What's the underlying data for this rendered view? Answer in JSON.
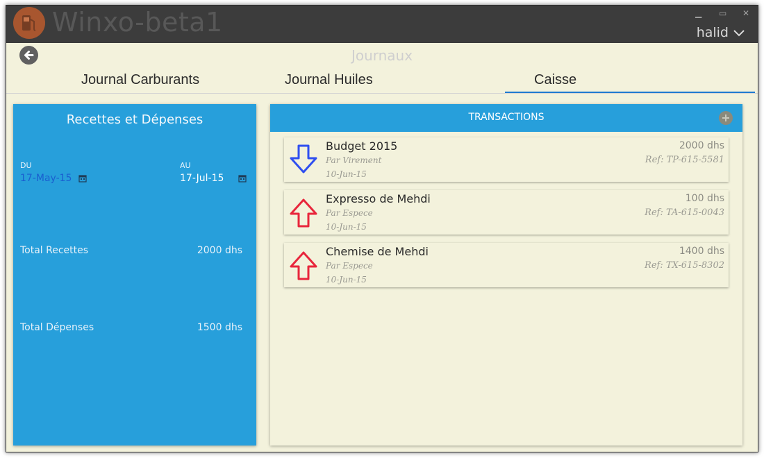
{
  "app": {
    "title": "Winxo-beta1",
    "logo_icon": "fuel-pump-icon"
  },
  "window_controls": {
    "minimize": "▁",
    "maximize": "▭",
    "close": "✕"
  },
  "user": {
    "name": "halid"
  },
  "page": {
    "title": "Journaux"
  },
  "tabs": [
    {
      "label": "Journal Carburants",
      "selected": false
    },
    {
      "label": "Journal Huiles",
      "selected": false
    },
    {
      "label": "Caisse",
      "selected": true
    }
  ],
  "summary": {
    "title": "Recettes et Dépenses",
    "from_label": "DU",
    "from_date": "17-May-15",
    "to_label": "AU",
    "to_date": "17-Jul-15",
    "total_income_label": "Total Recettes",
    "total_income": "2000 dhs",
    "total_expense_label": "Total Dépenses",
    "total_expense": "1500 dhs"
  },
  "transactions": {
    "header": "TRANSACTIONS",
    "items": [
      {
        "name": "Budget 2015",
        "method": "Par Virement",
        "date": "10-Jun-15",
        "amount": "2000 dhs",
        "ref": "Ref: TP-615-5581",
        "direction": "in",
        "color": "#2f4ff0"
      },
      {
        "name": "Expresso de Mehdi",
        "method": "Par Espece",
        "date": "10-Jun-15",
        "amount": "100 dhs",
        "ref": "Ref: TA-615-0043",
        "direction": "out",
        "color": "#e8263c"
      },
      {
        "name": "Chemise de Mehdi",
        "method": "Par Espece",
        "date": "10-Jun-15",
        "amount": "1400 dhs",
        "ref": "Ref: TX-615-8302",
        "direction": "out",
        "color": "#e8263c"
      }
    ]
  },
  "colors": {
    "accent": "#279fdb",
    "background": "#f3f2dc",
    "titlebar": "#3c3c3c",
    "tab_underline": "#1e7ad0",
    "income_arrow": "#2f4ff0",
    "expense_arrow": "#e8263c",
    "date_highlight": "#1a5fd0"
  }
}
